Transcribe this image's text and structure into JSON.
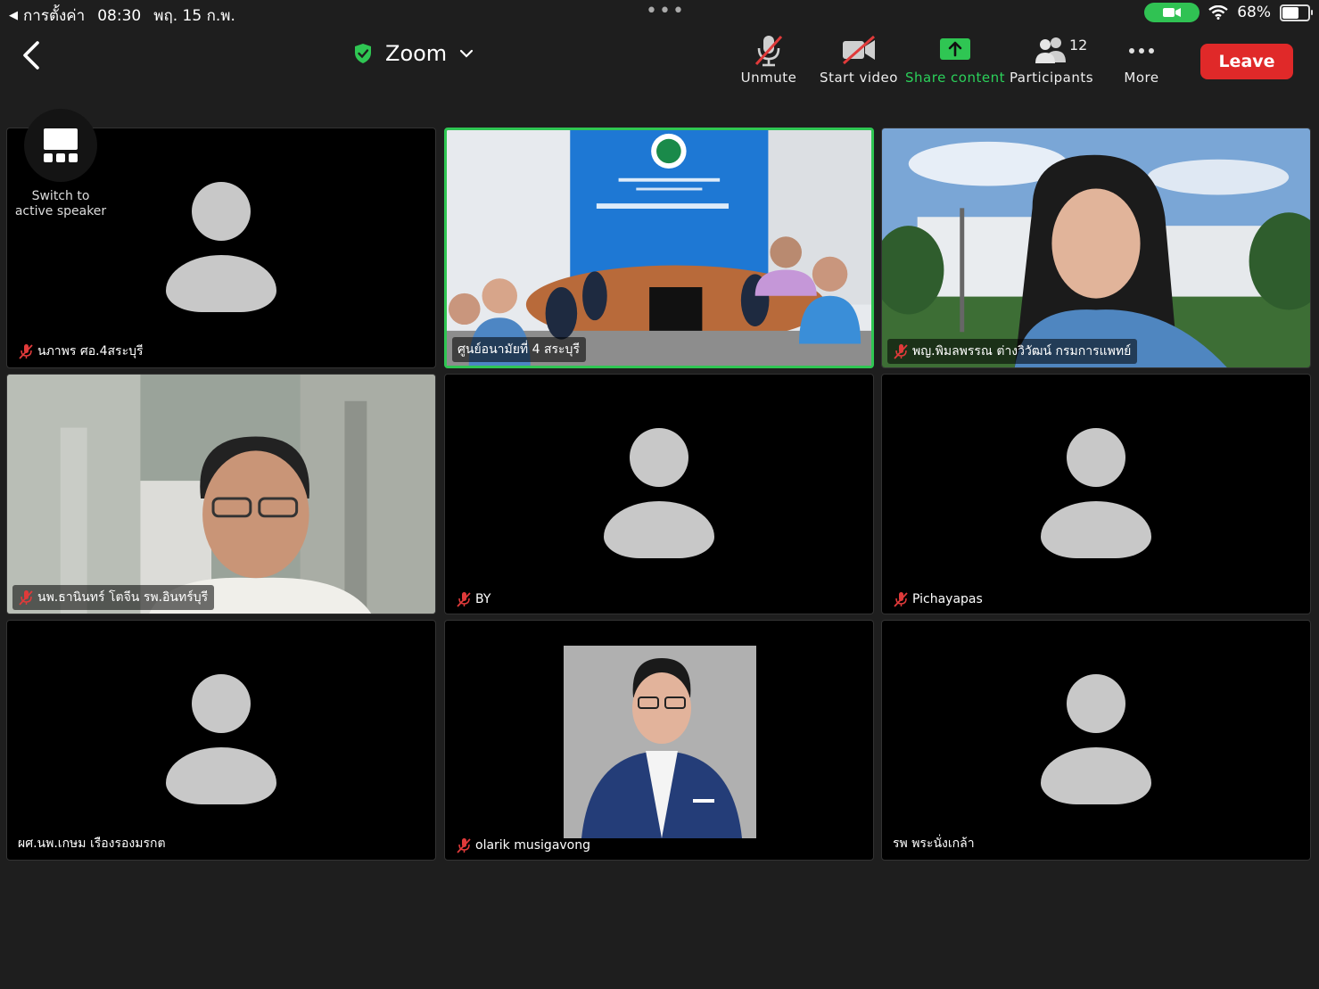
{
  "status_bar": {
    "back_app": "การตั้งค่า",
    "time": "08:30",
    "date": "พฤ. 15 ก.พ.",
    "battery": "68%",
    "battery_level": 0.68
  },
  "header": {
    "title": "Zoom"
  },
  "toolbar": {
    "unmute": "Unmute",
    "start_video": "Start video",
    "share_content": "Share content",
    "participants": "Participants",
    "participants_count": "12",
    "more": "More",
    "leave": "Leave"
  },
  "switch_view": {
    "label": "Switch to active speaker"
  },
  "participants": [
    {
      "name": "นภาพร ศอ.4สระบุรี",
      "muted": true,
      "video": false
    },
    {
      "name": "ศูนย์อนามัยที่ 4 สระบุรี",
      "muted": false,
      "video": true,
      "speaking": true
    },
    {
      "name": "พญ.พิมลพรรณ ต่างวิวัฒน์ กรมการแพทย์",
      "muted": true,
      "video": true
    },
    {
      "name": "นพ.ธานินทร์ โตจีน รพ.อินทร์บุรี",
      "muted": true,
      "video": true
    },
    {
      "name": "BY",
      "muted": true,
      "video": false
    },
    {
      "name": "Pichayapas",
      "muted": true,
      "video": false
    },
    {
      "name": "ผศ.นพ.เกษม เรืองรองมรกต",
      "muted": false,
      "video": false
    },
    {
      "name": "olarik musigavong",
      "muted": true,
      "video": false,
      "profile_photo": true
    },
    {
      "name": "รพ พระนั่งเกล้า",
      "muted": false,
      "video": false
    }
  ],
  "colors": {
    "accent_green": "#2fc653",
    "leave_red": "#e02929",
    "muted_red": "#e03a3a"
  }
}
